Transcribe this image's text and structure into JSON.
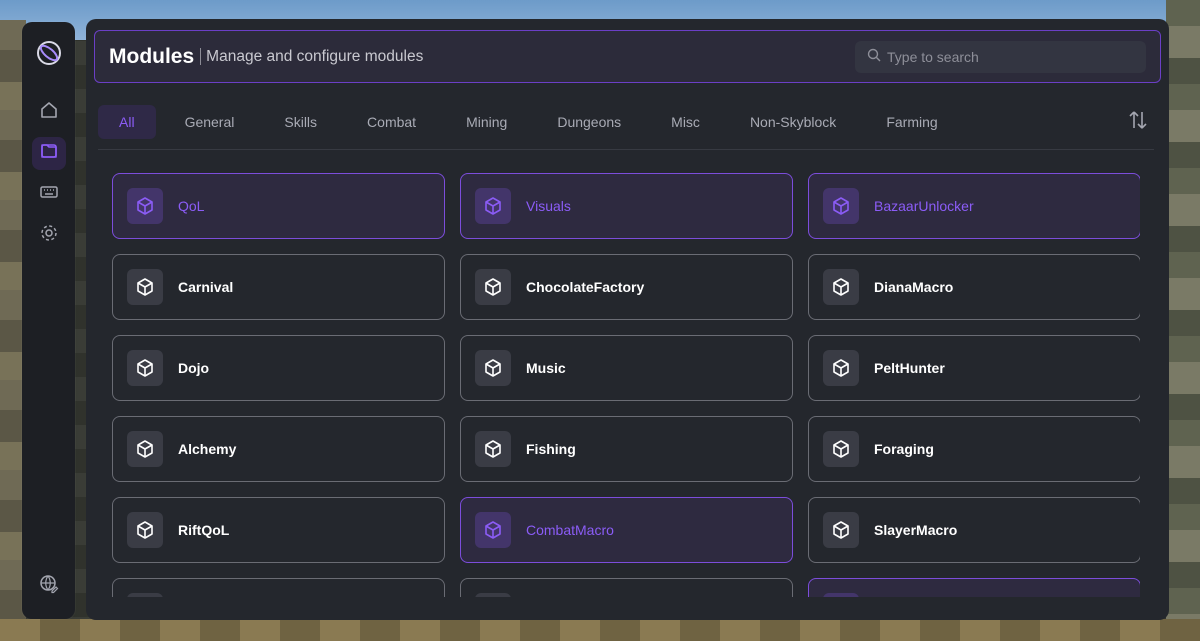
{
  "header": {
    "title": "Modules",
    "subtitle": "Manage and configure modules",
    "search_placeholder": "Type to search"
  },
  "sidebar": {
    "logo_icon": "ring-logo-icon",
    "items": [
      {
        "name": "home",
        "icon": "home-icon",
        "active": false
      },
      {
        "name": "modules",
        "icon": "folder-icon",
        "active": true
      },
      {
        "name": "keybinds",
        "icon": "keyboard-icon",
        "active": false
      },
      {
        "name": "settings",
        "icon": "gear-icon",
        "active": false
      }
    ],
    "bottom_icon": "globe-edit-icon"
  },
  "tabs": [
    {
      "label": "All",
      "active": true
    },
    {
      "label": "General",
      "active": false
    },
    {
      "label": "Skills",
      "active": false
    },
    {
      "label": "Combat",
      "active": false
    },
    {
      "label": "Mining",
      "active": false
    },
    {
      "label": "Dungeons",
      "active": false
    },
    {
      "label": "Misc",
      "active": false
    },
    {
      "label": "Non-Skyblock",
      "active": false
    },
    {
      "label": "Farming",
      "active": false
    }
  ],
  "sort_icon": "sort-arrows-icon",
  "modules": [
    {
      "name": "QoL",
      "enabled": true
    },
    {
      "name": "Visuals",
      "enabled": true
    },
    {
      "name": "BazaarUnlocker",
      "enabled": true
    },
    {
      "name": "Carnival",
      "enabled": false
    },
    {
      "name": "ChocolateFactory",
      "enabled": false
    },
    {
      "name": "DianaMacro",
      "enabled": false
    },
    {
      "name": "Dojo",
      "enabled": false
    },
    {
      "name": "Music",
      "enabled": false
    },
    {
      "name": "PeltHunter",
      "enabled": false
    },
    {
      "name": "Alchemy",
      "enabled": false
    },
    {
      "name": "Fishing",
      "enabled": false
    },
    {
      "name": "Foraging",
      "enabled": false
    },
    {
      "name": "RiftQoL",
      "enabled": false
    },
    {
      "name": "CombatMacro",
      "enabled": true
    },
    {
      "name": "SlayerMacro",
      "enabled": false
    },
    {
      "name": "",
      "enabled": false
    },
    {
      "name": "",
      "enabled": false
    },
    {
      "name": "",
      "enabled": true
    }
  ],
  "colors": {
    "accent": "#8b5cf6",
    "panel": "#24272d",
    "sidebar": "#1d1f24"
  }
}
